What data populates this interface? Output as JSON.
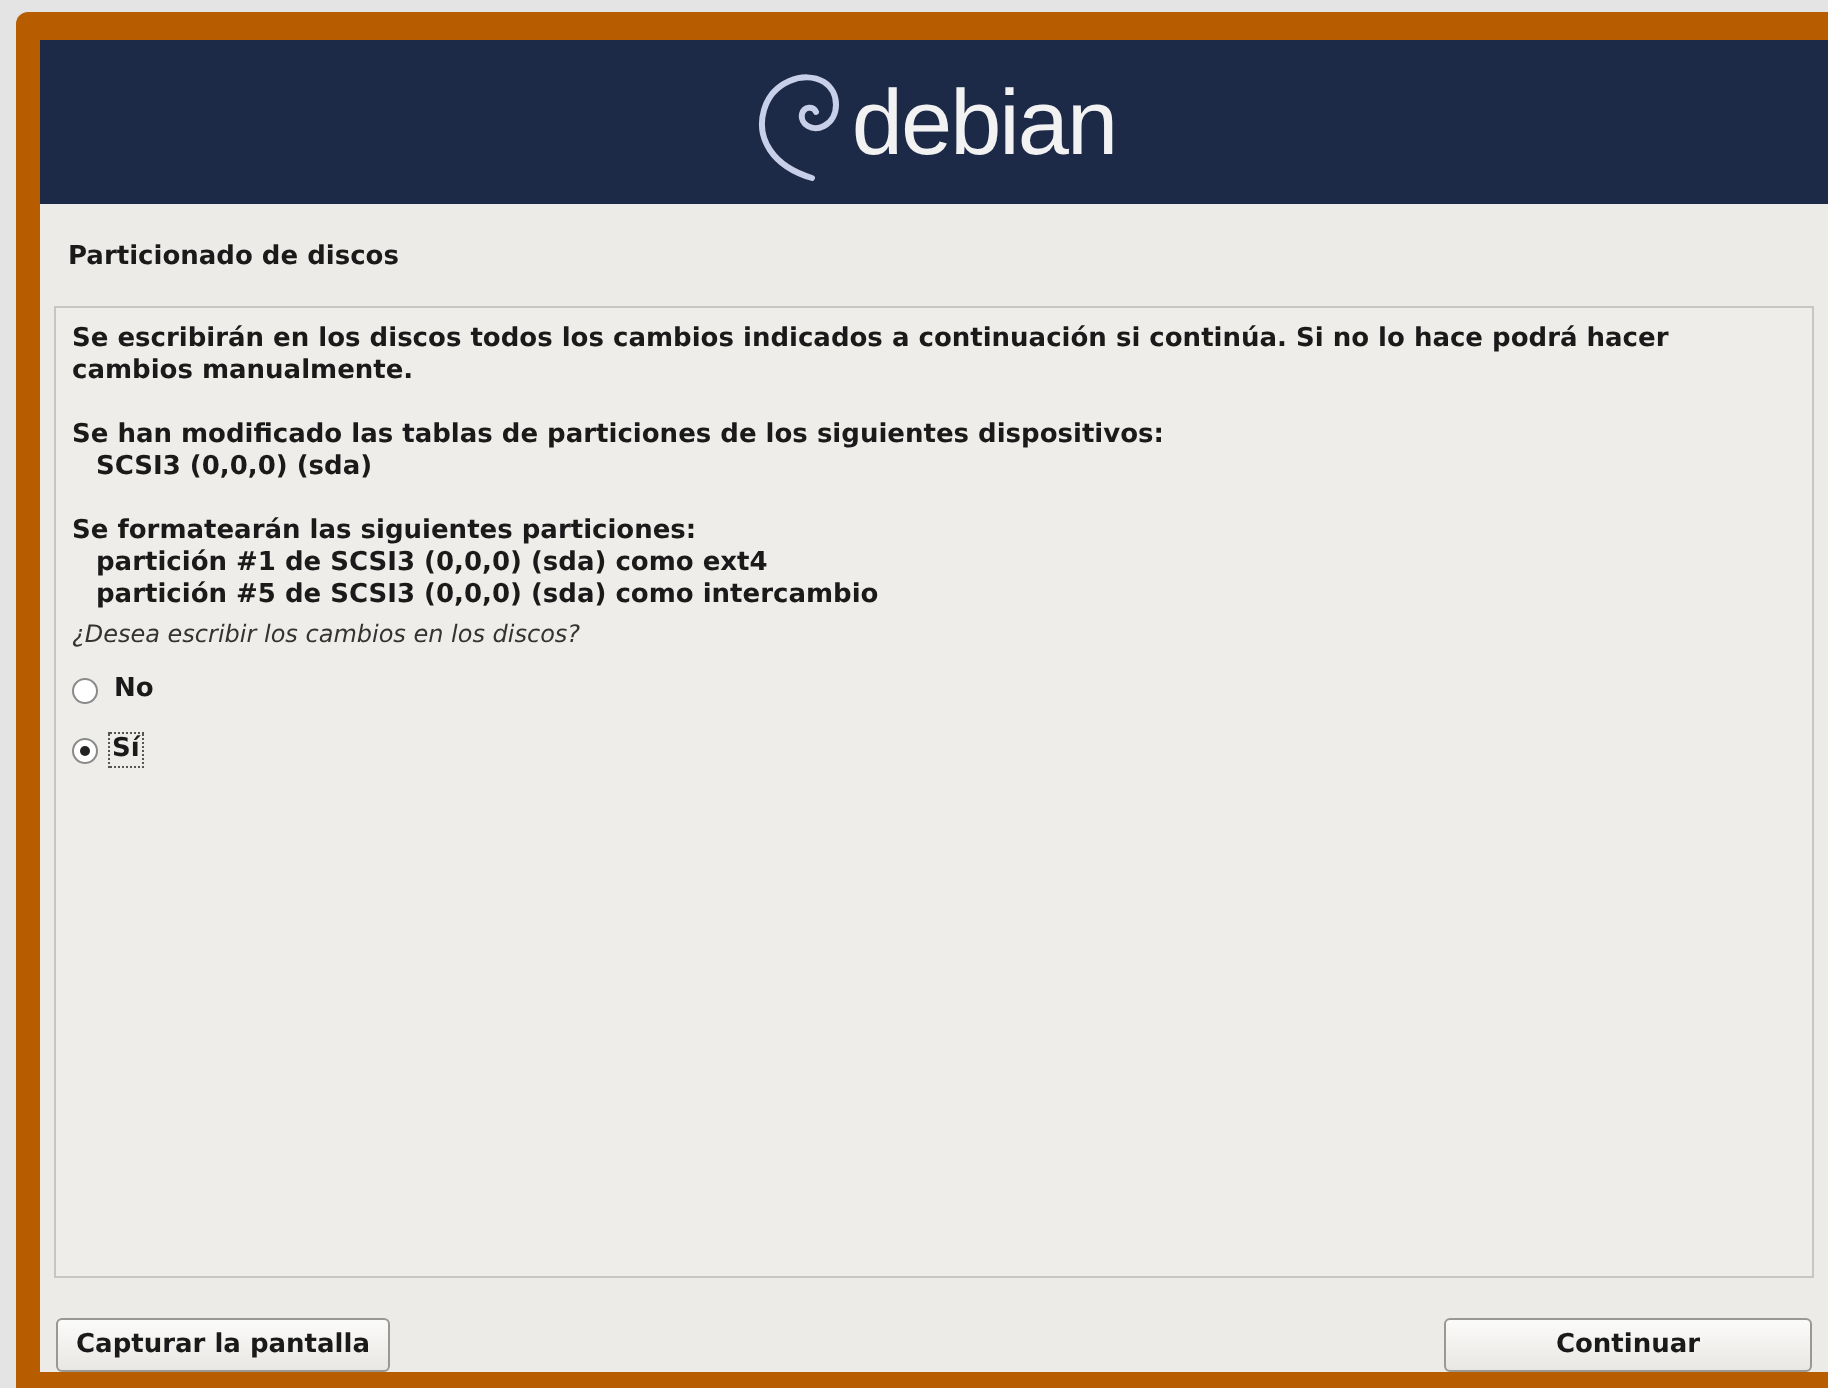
{
  "header": {
    "logo_text": "debian"
  },
  "title": "Particionado de discos",
  "intro": "Se escribirán en los discos todos los cambios indicados a continuación si continúa. Si no lo hace podrá hacer cambios manualmente.",
  "sections": [
    {
      "heading": "Se han modificado las tablas de particiones de los siguientes dispositivos:",
      "items": [
        "SCSI3 (0,0,0) (sda)"
      ]
    },
    {
      "heading": "Se formatearán las siguientes particiones:",
      "items": [
        "partición #1 de SCSI3 (0,0,0) (sda) como ext4",
        "partición #5 de SCSI3 (0,0,0) (sda) como intercambio"
      ]
    }
  ],
  "question": "¿Desea escribir los cambios en los discos?",
  "options": [
    {
      "label": "No",
      "selected": false
    },
    {
      "label": "Sí",
      "selected": true
    }
  ],
  "buttons": [
    {
      "label": "Capturar la pantalla"
    },
    {
      "label": "Continuar"
    }
  ]
}
